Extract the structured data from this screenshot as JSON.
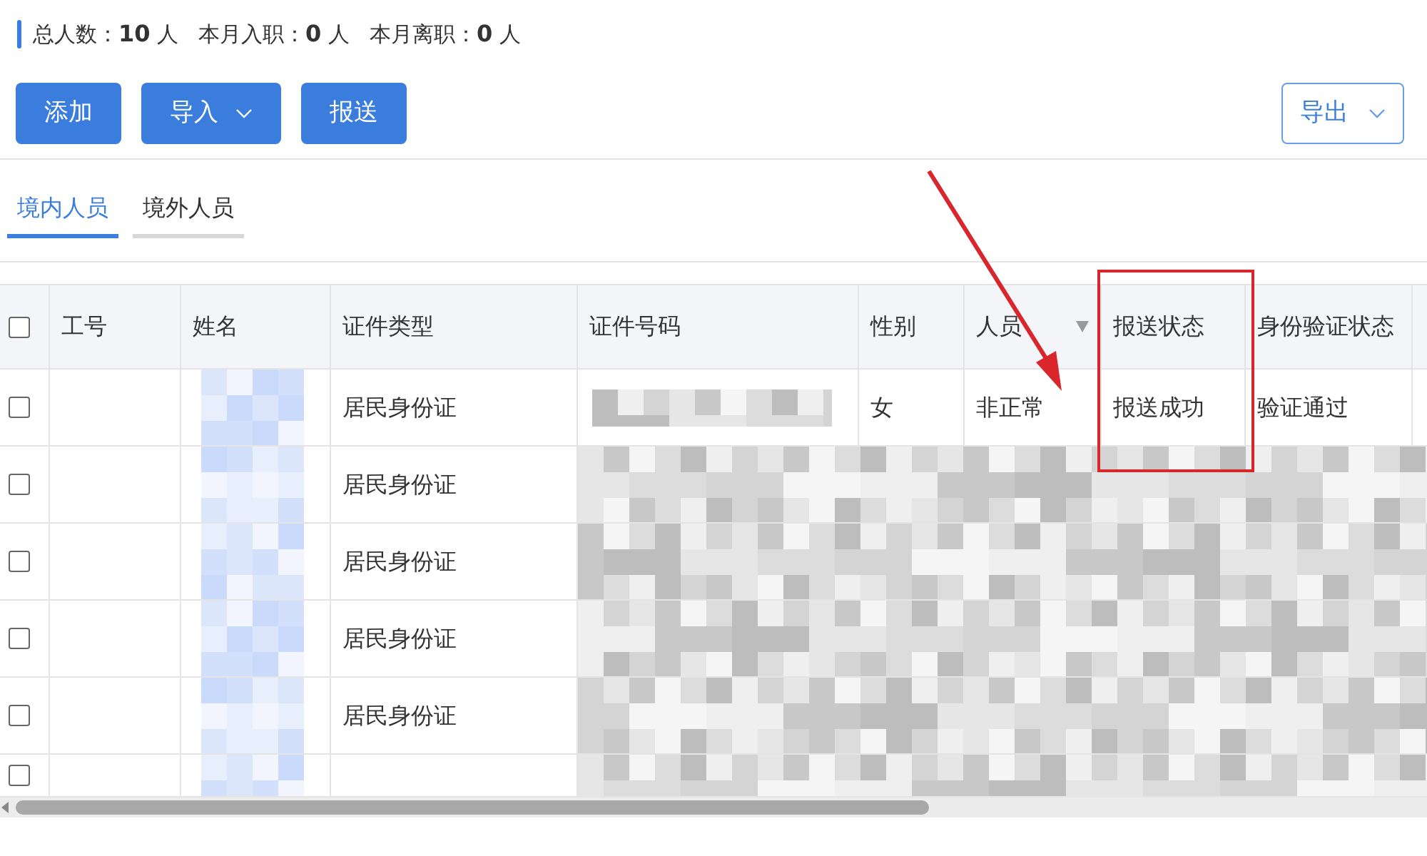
{
  "summary": [
    {
      "label": "总人数：",
      "value": "10",
      "unit": "人"
    },
    {
      "label": "本月入职：",
      "value": "0",
      "unit": "人"
    },
    {
      "label": "本月离职：",
      "value": "0",
      "unit": "人"
    }
  ],
  "toolbar": {
    "buttons": [
      {
        "label": "添加",
        "kind": "plain"
      },
      {
        "label": "导入",
        "kind": "dropdown"
      },
      {
        "label": "报送",
        "kind": "plain"
      }
    ],
    "export": {
      "label": "导出"
    }
  },
  "tabs": [
    {
      "label": "境内人员",
      "selected": true
    },
    {
      "label": "境外人员",
      "selected": false
    }
  ],
  "table": {
    "all_checked": false,
    "columns": [
      {
        "label": "工号",
        "filter": false
      },
      {
        "label": "姓名",
        "filter": false
      },
      {
        "label": "证件类型",
        "filter": false
      },
      {
        "label": "证件号码",
        "filter": false
      },
      {
        "label": "性别",
        "filter": false
      },
      {
        "label": "人员",
        "filter": true
      },
      {
        "label": "报送状态",
        "filter": false
      },
      {
        "label": "身份验证状态",
        "filter": false
      }
    ],
    "rows": [
      {
        "kind": "partly_redacted",
        "checked": false,
        "id_type": "居民身份证",
        "gender": "女",
        "staff_type": "非正常",
        "report_status": "报送成功",
        "verify_status": "验证通过"
      },
      {
        "kind": "redacted",
        "checked": false,
        "id_type": "居民身份证"
      },
      {
        "kind": "redacted",
        "checked": false,
        "id_type": "居民身份证"
      },
      {
        "kind": "redacted",
        "checked": false,
        "id_type": "居民身份证"
      },
      {
        "kind": "redacted",
        "checked": false,
        "id_type": "居民身份证"
      },
      {
        "kind": "redacted",
        "checked": false
      }
    ]
  }
}
